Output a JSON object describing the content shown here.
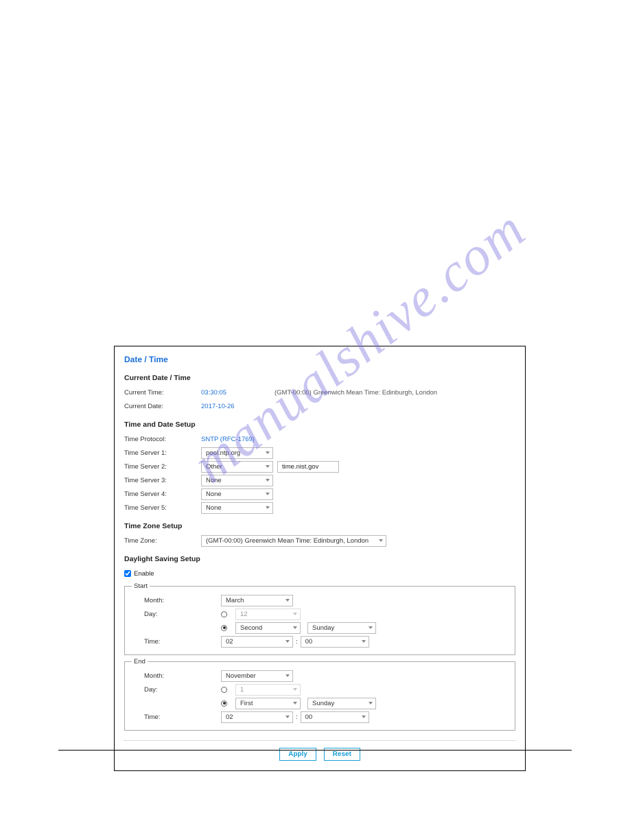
{
  "watermark": "manualshive.com",
  "title": "Date / Time",
  "currentDateTime": {
    "heading": "Current Date / Time",
    "time_label": "Current Time:",
    "time_value": "03:30:05",
    "tz_note": "(GMT-00:00) Greenwich Mean Time: Edinburgh, London",
    "date_label": "Current Date:",
    "date_value": "2017-10-26"
  },
  "timeDateSetup": {
    "heading": "Time and Date Setup",
    "protocol_label": "Time Protocol:",
    "protocol_value": "SNTP (RFC-1769)",
    "server1_label": "Time Server 1:",
    "server1_value": "pool.ntp.org",
    "server2_label": "Time Server 2:",
    "server2_value": "Other",
    "server2_text": "time.nist.gov",
    "server3_label": "Time Server 3:",
    "server3_value": "None",
    "server4_label": "Time Server 4:",
    "server4_value": "None",
    "server5_label": "Time Server 5:",
    "server5_value": "None"
  },
  "timeZone": {
    "heading": "Time Zone Setup",
    "label": "Time Zone:",
    "value": "(GMT-00:00) Greenwich Mean Time: Edinburgh, London"
  },
  "dst": {
    "heading": "Daylight Saving Setup",
    "enable_label": "Enable",
    "start": {
      "legend": "Start",
      "month_label": "Month:",
      "month_value": "March",
      "day_label": "Day:",
      "day_num": "12",
      "week": "Second",
      "weekday": "Sunday",
      "time_label": "Time:",
      "hour": "02",
      "minute": "00"
    },
    "end": {
      "legend": "End",
      "month_label": "Month:",
      "month_value": "November",
      "day_label": "Day:",
      "day_num": "1",
      "week": "First",
      "weekday": "Sunday",
      "time_label": "Time:",
      "hour": "02",
      "minute": "00"
    }
  },
  "buttons": {
    "apply": "Apply",
    "reset": "Reset"
  }
}
